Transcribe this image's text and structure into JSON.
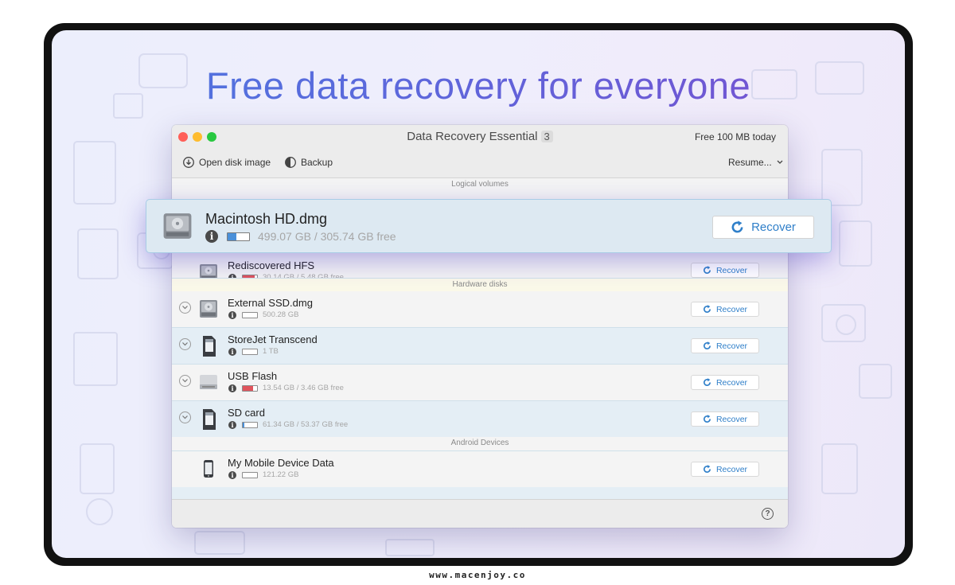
{
  "headline": "Free data recovery for everyone",
  "window": {
    "title": "Data Recovery Essential",
    "title_badge": "3",
    "free_text": "Free 100 MB today",
    "toolbar": {
      "open_disk_image": "Open disk image",
      "backup": "Backup",
      "resume": "Resume..."
    }
  },
  "sections": {
    "logical": "Logical volumes",
    "hardware": "Hardware disks",
    "android": "Android Devices"
  },
  "selected_volume": {
    "name": "Macintosh HD.dmg",
    "size": "499.07 GB / 305.74 GB free",
    "used_fraction": 0.39,
    "recover_label": "Recover"
  },
  "logical_volumes": [
    {
      "name": "Rediscovered HFS",
      "size": "30.14 GB / 5.48 GB free",
      "used_fraction": 0.82,
      "bar_color": "#e0545c",
      "recover_label": "Recover"
    }
  ],
  "hardware_disks": [
    {
      "name": "External SSD.dmg",
      "size": "500.28 GB",
      "used_fraction": 0.0,
      "bar_color": "#4a90d9",
      "icon": "drive-icon",
      "recover_label": "Recover"
    },
    {
      "name": "StoreJet Transcend",
      "size": "1 TB",
      "used_fraction": 0.0,
      "bar_color": "#4a90d9",
      "icon": "sd-card-icon",
      "recover_label": "Recover"
    },
    {
      "name": "USB Flash",
      "size": "13.54 GB / 3.46 GB free",
      "used_fraction": 0.74,
      "bar_color": "#e0545c",
      "icon": "usb-flash-icon",
      "recover_label": "Recover"
    },
    {
      "name": "SD card",
      "size": "61.34 GB / 53.37 GB free",
      "used_fraction": 0.13,
      "bar_color": "#4a90d9",
      "icon": "sd-card-icon",
      "recover_label": "Recover"
    }
  ],
  "android_devices": [
    {
      "name": "My Mobile Device Data",
      "size": "121.22 GB",
      "used_fraction": 0.0,
      "bar_color": "#4a90d9",
      "icon": "phone-icon",
      "recover_label": "Recover"
    }
  ],
  "site_url": "www.macenjoy.co",
  "colors": {
    "accent": "#2f7fc9",
    "row_alt": "#e4eef5",
    "selected_bg": "#dde9f2",
    "section_bg": "#fbf9e9"
  }
}
